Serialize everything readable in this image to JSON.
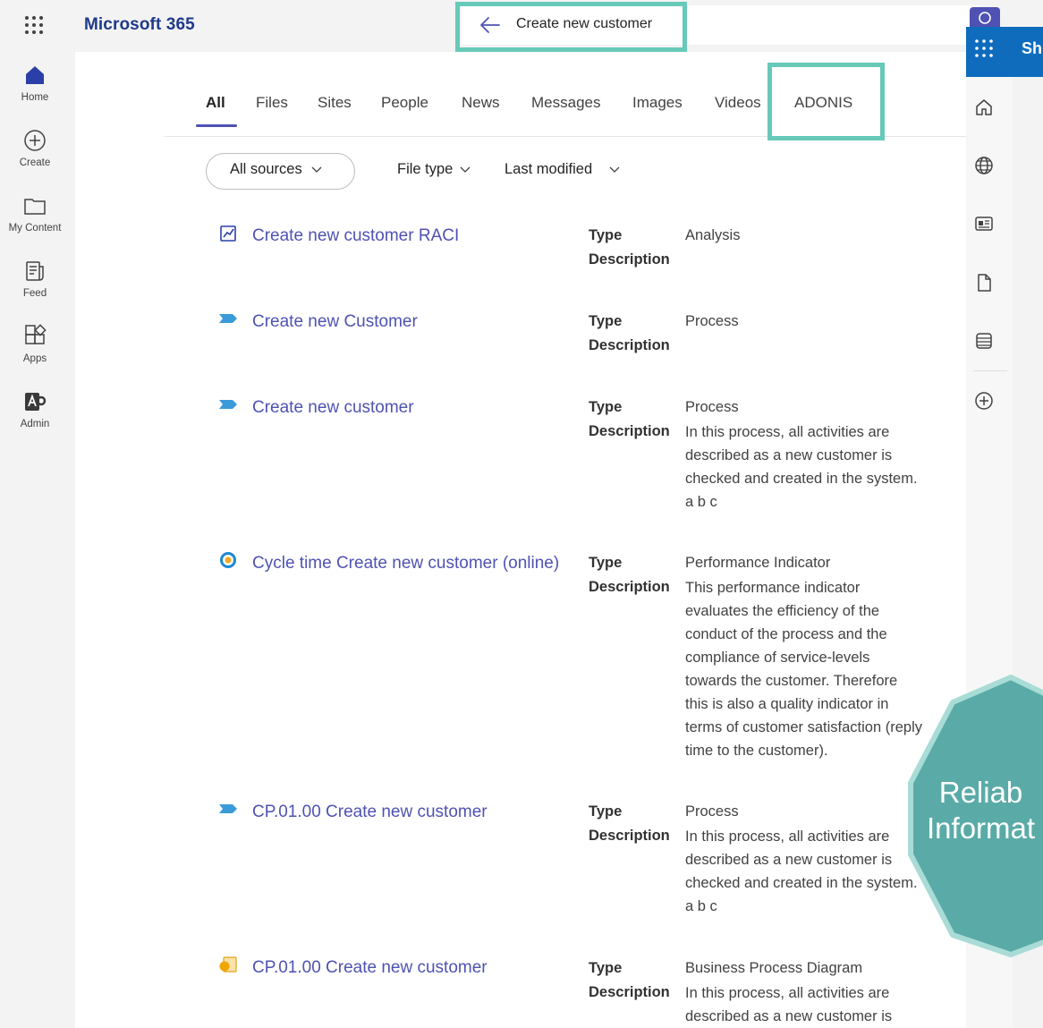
{
  "app": {
    "brand": "Microsoft 365",
    "waffle_icon": "waffle-icon"
  },
  "search": {
    "query": "Create new customer",
    "back_icon": "arrow-left-icon",
    "submit_icon": "search-icon"
  },
  "rail": [
    {
      "label": "Home",
      "icon": "home-icon"
    },
    {
      "label": "Create",
      "icon": "plus-circle-icon"
    },
    {
      "label": "My Content",
      "icon": "folder-icon"
    },
    {
      "label": "Feed",
      "icon": "feed-icon"
    },
    {
      "label": "Apps",
      "icon": "apps-icon"
    },
    {
      "label": "Admin",
      "icon": "admin-icon"
    }
  ],
  "tabs": [
    "All",
    "Files",
    "Sites",
    "People",
    "News",
    "Messages",
    "Images",
    "Videos",
    "ADONIS"
  ],
  "filters": {
    "sources": "All sources",
    "file_type": "File type",
    "last_modified": "Last modified"
  },
  "labels": {
    "type": "Type",
    "description": "Description"
  },
  "results": [
    {
      "title": "Create new customer RACI",
      "type": "Analysis",
      "description": "",
      "icon": "analysis-icon"
    },
    {
      "title": "Create new Customer",
      "type": "Process",
      "description": "",
      "icon": "process-arrow-icon"
    },
    {
      "title": "Create new customer",
      "type": "Process",
      "description": "In this process, all activities are described as a new customer is checked and created in the system. a b c",
      "icon": "process-arrow-icon"
    },
    {
      "title": "Cycle time Create new customer (online)",
      "type": "Performance Indicator",
      "description": "This performance indicator evaluates the efficiency of the conduct of the process and the compliance of service-levels towards the customer. Therefore this is also a quality indicator in terms of customer satisfaction (reply time to the customer).",
      "icon": "target-icon"
    },
    {
      "title": "CP.01.00 Create new customer",
      "type": "Process",
      "description": "In this process, all activities are described as a new customer is checked and created in the system. a b c",
      "icon": "process-arrow-icon"
    },
    {
      "title": "CP.01.00 Create new customer",
      "type": "Business Process Diagram",
      "description": "In this process, all activities are described as a new customer is",
      "icon": "diagram-icon"
    }
  ],
  "right_panel": {
    "title": "Sh",
    "icons": [
      "home-outline-icon",
      "globe-icon",
      "news-icon",
      "document-icon",
      "database-icon",
      "add-icon"
    ]
  },
  "badge": {
    "line1": "Reliab",
    "line2": "Informat"
  },
  "colors": {
    "accent": "#4f52b2",
    "highlight": "#67c9b8",
    "badge": "#5aaba7",
    "right_header": "#0f6cbd"
  }
}
